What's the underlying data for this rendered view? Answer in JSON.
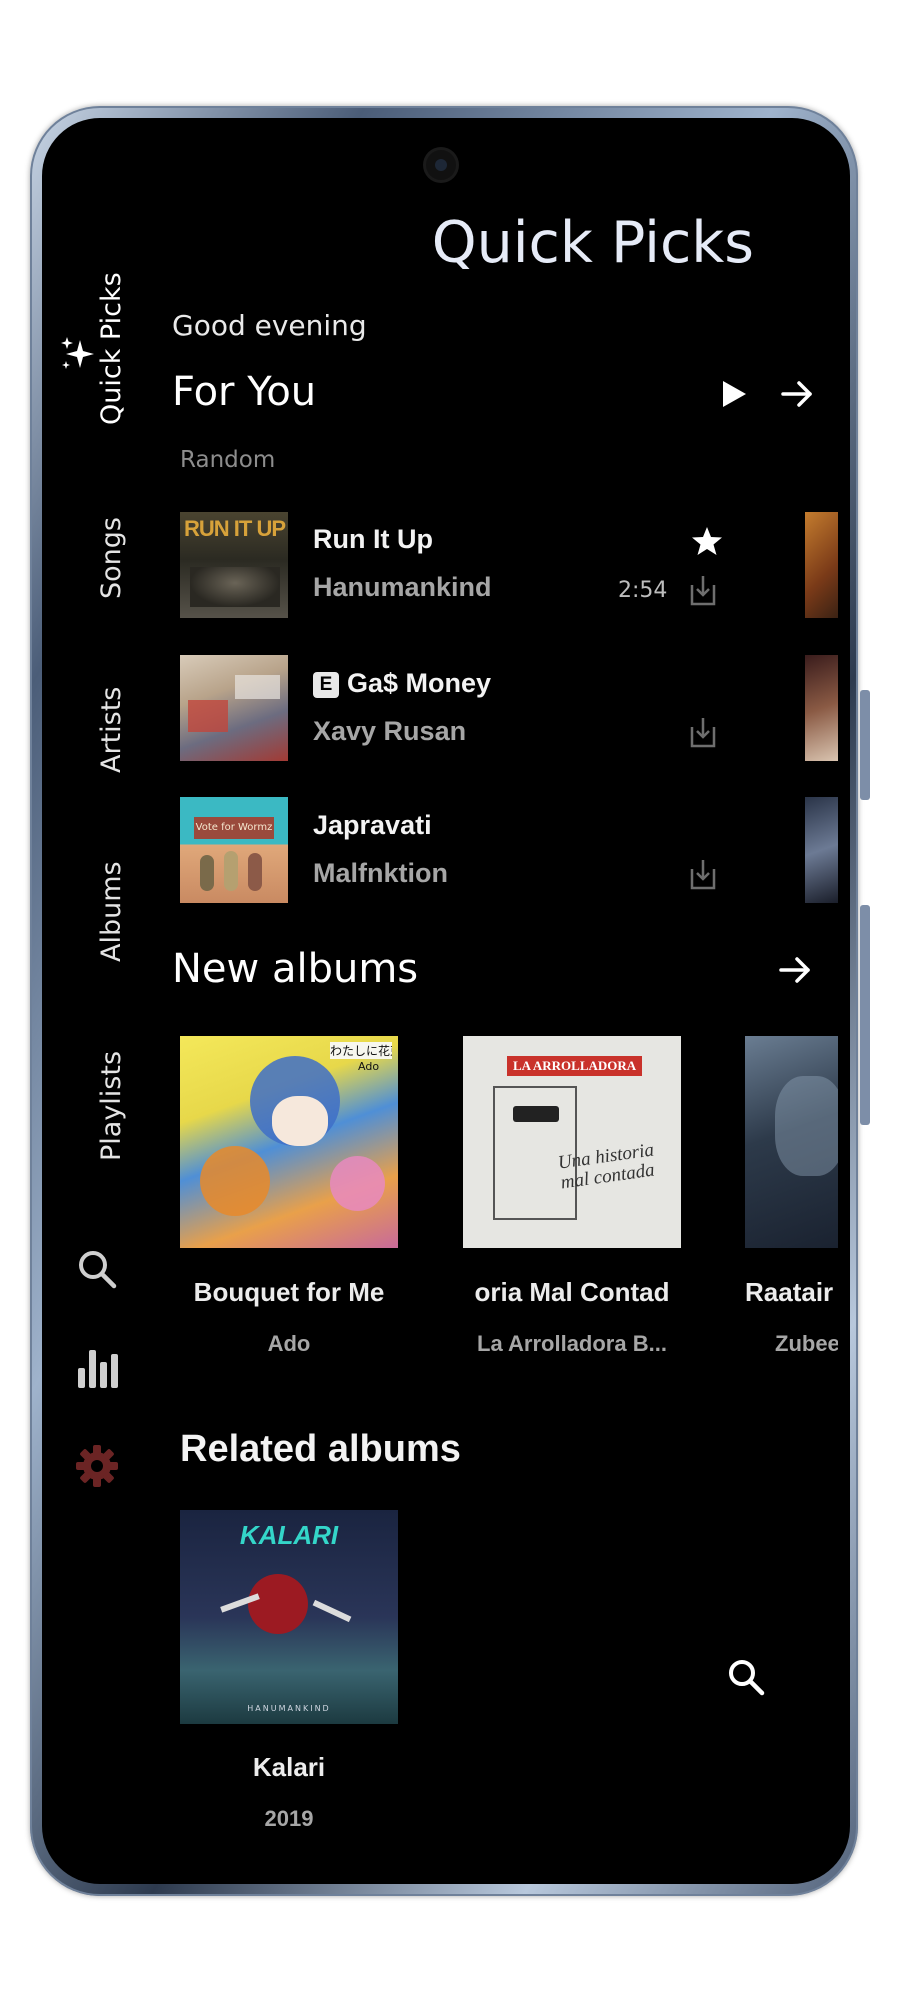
{
  "header": {
    "title": "Quick Picks"
  },
  "nav": {
    "items": [
      {
        "label": "Quick Picks",
        "icon": "sparkles-icon",
        "active": true
      },
      {
        "label": "Songs",
        "active": false
      },
      {
        "label": "Artists",
        "active": false
      },
      {
        "label": "Albums",
        "active": false
      },
      {
        "label": "Playlists",
        "active": false
      }
    ],
    "bottom_icons": [
      "search-icon",
      "bar-chart-icon",
      "gear-icon"
    ]
  },
  "greeting": "Good evening",
  "for_you": {
    "title": "For You",
    "subtitle": "Random",
    "songs": [
      {
        "title": "Run It Up",
        "artist": "Hanumankind",
        "duration": "2:54",
        "explicit": false,
        "favorite": true
      },
      {
        "title": "Ga$ Money",
        "artist": "Xavy Rusan",
        "duration": "",
        "explicit": true,
        "explicit_label": "E",
        "favorite": false
      },
      {
        "title": "Japravati",
        "artist": "Malfnktion",
        "duration": "",
        "explicit": false,
        "favorite": false
      }
    ]
  },
  "new_albums": {
    "title": "New albums",
    "albums": [
      {
        "title": "Bouquet for Me",
        "artist": "Ado"
      },
      {
        "title": "oria Mal Contad",
        "artist": "La Arrolladora B..."
      },
      {
        "title": "Raatair",
        "artist": "Zubee"
      }
    ]
  },
  "related_albums": {
    "title": "Related albums",
    "albums": [
      {
        "title": "Kalari",
        "year": "2019"
      }
    ]
  },
  "art_text": {
    "run_it_up": "RUN IT UP",
    "vote": "Vote for Wormz",
    "kalari": "KALARI",
    "hanumankind": "HANUMANKIND",
    "ado_jp": "わたしに花束",
    "ado": "Ado",
    "arrolladora": "LA ARROLLADORA",
    "una_historia": "Una historia mal contada"
  },
  "colors": {
    "background": "#000000",
    "accent_title": "#e6ebf7",
    "gear": "#6b2424",
    "muted": "#a6a6a6"
  }
}
